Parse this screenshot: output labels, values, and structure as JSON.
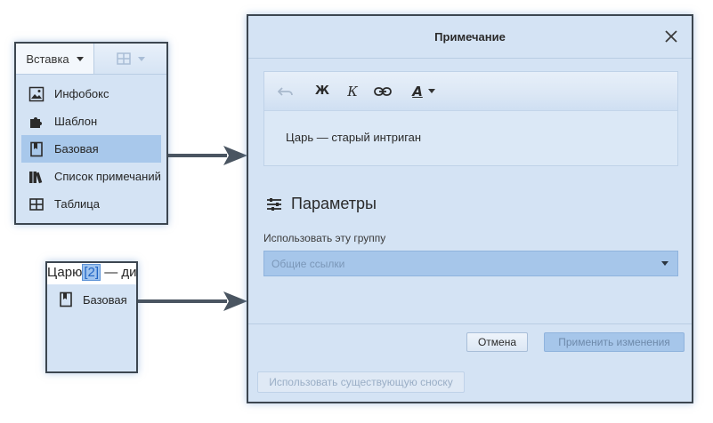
{
  "insert_menu": {
    "insert_button_label": "Вставка",
    "table_button_icon": "table-grid-icon",
    "items": [
      {
        "label": "Инфобокс",
        "icon": "image-infobox-icon",
        "active": false
      },
      {
        "label": "Шаблон",
        "icon": "puzzle-template-icon",
        "active": false
      },
      {
        "label": "Базовая",
        "icon": "bookmark-note-icon",
        "active": true
      },
      {
        "label": "Список примечаний",
        "icon": "books-list-icon",
        "active": false
      },
      {
        "label": "Таблица",
        "icon": "table-icon",
        "active": false
      }
    ]
  },
  "inline_popup": {
    "text_before": "Царю",
    "note_marker": "[2]",
    "text_after": " — ди",
    "item_label": "Базовая",
    "item_icon": "bookmark-note-icon"
  },
  "dialog": {
    "title": "Примечание",
    "close_icon": "close-icon",
    "editor": {
      "toolbar": {
        "undo_icon": "undo-icon",
        "bold_label": "Ж",
        "italic_label": "К",
        "link_icon": "link-icon",
        "text_color_label": "A"
      },
      "content": "Царь — старый интриган"
    },
    "params": {
      "icon": "sliders-icon",
      "title": "Параметры",
      "group_label": "Использовать эту группу",
      "group_select_placeholder": "Общие ссылки"
    },
    "cancel_label": "Отмена",
    "apply_label": "Применить изменения",
    "use_existing_label": "Использовать существующую сноску"
  },
  "colors": {
    "panel_background": "#d4e3f4",
    "panel_border": "#3c4650",
    "active_item": "#a8c8eb",
    "select_background": "#a6c6ea",
    "arrow": "#4a5561"
  }
}
